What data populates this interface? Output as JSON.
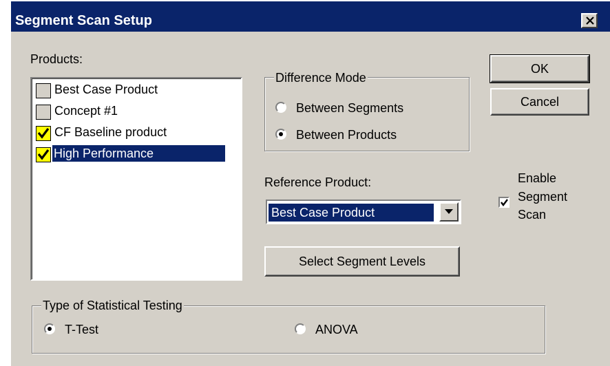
{
  "window": {
    "title": "Segment Scan Setup"
  },
  "products": {
    "label": "Products:",
    "items": [
      {
        "label": "Best Case Product",
        "checked": false,
        "selected": false
      },
      {
        "label": "Concept #1",
        "checked": false,
        "selected": false
      },
      {
        "label": "CF Baseline product",
        "checked": true,
        "selected": false
      },
      {
        "label": "High Performance",
        "checked": true,
        "selected": true
      }
    ]
  },
  "difference_mode": {
    "label": "Difference Mode",
    "options": [
      {
        "label": "Between Segments",
        "selected": false
      },
      {
        "label": "Between Products",
        "selected": true
      }
    ]
  },
  "reference_product": {
    "label": "Reference Product:",
    "value": "Best Case Product"
  },
  "select_segment_levels": {
    "label": "Select Segment Levels"
  },
  "buttons": {
    "ok": "OK",
    "cancel": "Cancel"
  },
  "enable_segment_scan": {
    "line1": "Enable",
    "line2": "Segment",
    "line3": "Scan",
    "checked": true
  },
  "statistical_testing": {
    "label": "Type of Statistical Testing",
    "options": [
      {
        "label": "T-Test",
        "selected": true
      },
      {
        "label": "ANOVA",
        "selected": false
      }
    ]
  },
  "colors": {
    "title_bar": "#0a246a",
    "dialog_face": "#d4d0c8",
    "selection": "#0a246a",
    "checked_box": "#ffff00"
  }
}
